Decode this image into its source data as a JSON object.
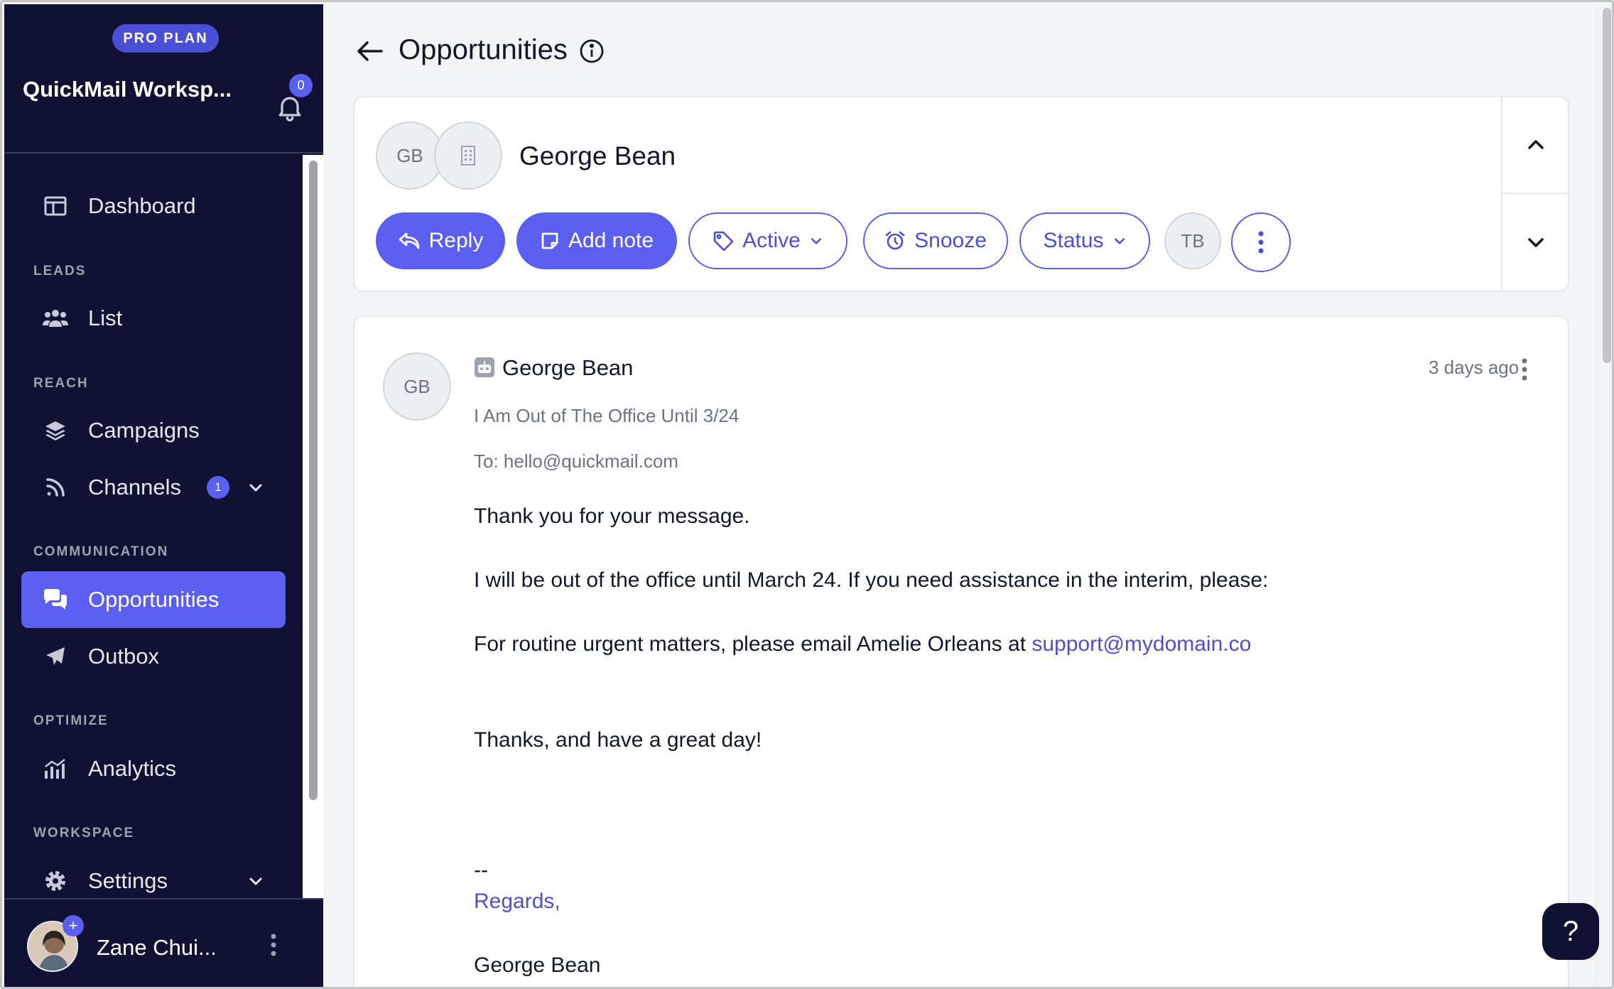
{
  "sidebar": {
    "plan": "PRO PLAN",
    "workspace": "QuickMail Worksp...",
    "notifications": "0",
    "sections": {
      "leads": "LEADS",
      "reach": "REACH",
      "communication": "COMMUNICATION",
      "optimize": "OPTIMIZE",
      "workspace": "WORKSPACE"
    },
    "items": {
      "dashboard": "Dashboard",
      "list": "List",
      "campaigns": "Campaigns",
      "channels": "Channels",
      "channels_badge": "1",
      "opportunities": "Opportunities",
      "outbox": "Outbox",
      "analytics": "Analytics",
      "settings": "Settings"
    },
    "user": "Zane Chui...",
    "user_badge": "+"
  },
  "header": {
    "title": "Opportunities"
  },
  "opportunity": {
    "initials": "GB",
    "name": "George Bean",
    "actions": {
      "reply": "Reply",
      "add_note": "Add note",
      "active": "Active",
      "snooze": "Snooze",
      "status": "Status"
    },
    "assignee": "TB"
  },
  "message": {
    "initials": "GB",
    "sender": "George Bean",
    "time": "3 days ago",
    "subject": "I Am Out of The Office Until 3/24",
    "to": "To: hello@quickmail.com",
    "line1": "Thank you for your message.",
    "line2": "I will be out of the office until March 24.  If you need assistance in the interim, please:",
    "line3": "For routine urgent matters, please email Amelie Orleans at ",
    "line3_link": "support@mydomain.co",
    "line4": "Thanks, and have a great day!",
    "sig_dash": "--",
    "sig_regards": "Regards,",
    "sig_name": "George Bean"
  },
  "help": "?",
  "colors": {
    "accent": "#5a5ff0",
    "sidebar_bg": "#111133"
  }
}
